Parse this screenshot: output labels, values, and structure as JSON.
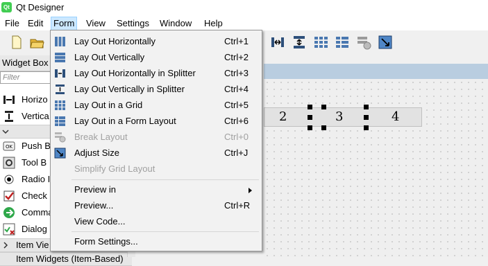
{
  "window": {
    "title": "Qt Designer",
    "app_icon_text": "Qt"
  },
  "menubar": [
    "File",
    "Edit",
    "Form",
    "View",
    "Settings",
    "Window",
    "Help"
  ],
  "widget_box": {
    "title": "Widget Box",
    "filter_placeholder": "Filter",
    "items": [
      "Horizo",
      "Vertica",
      "Push B",
      "Tool B",
      "Radio I",
      "Check",
      "Comma",
      "Dialog"
    ],
    "bottom_items": [
      "Item Vie",
      "Item Widgets (Item-Based)"
    ]
  },
  "form_canvas": {
    "labels": [
      "2",
      "3",
      "4"
    ]
  },
  "form_menu": {
    "items": [
      {
        "label": "Lay Out Horizontally",
        "shortcut": "Ctrl+1",
        "icon": "layout-horizontal-icon",
        "enabled": true
      },
      {
        "label": "Lay Out Vertically",
        "shortcut": "Ctrl+2",
        "icon": "layout-vertical-icon",
        "enabled": true
      },
      {
        "label": "Lay Out Horizontally in Splitter",
        "shortcut": "Ctrl+3",
        "icon": "splitter-horizontal-icon",
        "enabled": true
      },
      {
        "label": "Lay Out Vertically in Splitter",
        "shortcut": "Ctrl+4",
        "icon": "splitter-vertical-icon",
        "enabled": true
      },
      {
        "label": "Lay Out in a Grid",
        "shortcut": "Ctrl+5",
        "icon": "layout-grid-icon",
        "enabled": true
      },
      {
        "label": "Lay Out in a Form Layout",
        "shortcut": "Ctrl+6",
        "icon": "layout-form-icon",
        "enabled": true
      },
      {
        "label": "Break Layout",
        "shortcut": "Ctrl+0",
        "icon": "break-layout-icon",
        "enabled": false
      },
      {
        "label": "Adjust Size",
        "shortcut": "Ctrl+J",
        "icon": "adjust-size-icon",
        "enabled": true
      },
      {
        "label": "Simplify Grid Layout",
        "shortcut": "",
        "icon": "",
        "enabled": false
      }
    ],
    "preview_items": [
      {
        "label": "Preview in",
        "shortcut": "",
        "submenu": true
      },
      {
        "label": "Preview...",
        "shortcut": "Ctrl+R",
        "submenu": false
      },
      {
        "label": "View Code...",
        "shortcut": "",
        "submenu": false
      }
    ],
    "settings_item": {
      "label": "Form Settings...",
      "shortcut": ""
    }
  },
  "colors": {
    "menu_highlight": "#cce8ff",
    "form_title": "#b9cde0",
    "qt_green": "#41cd52"
  }
}
